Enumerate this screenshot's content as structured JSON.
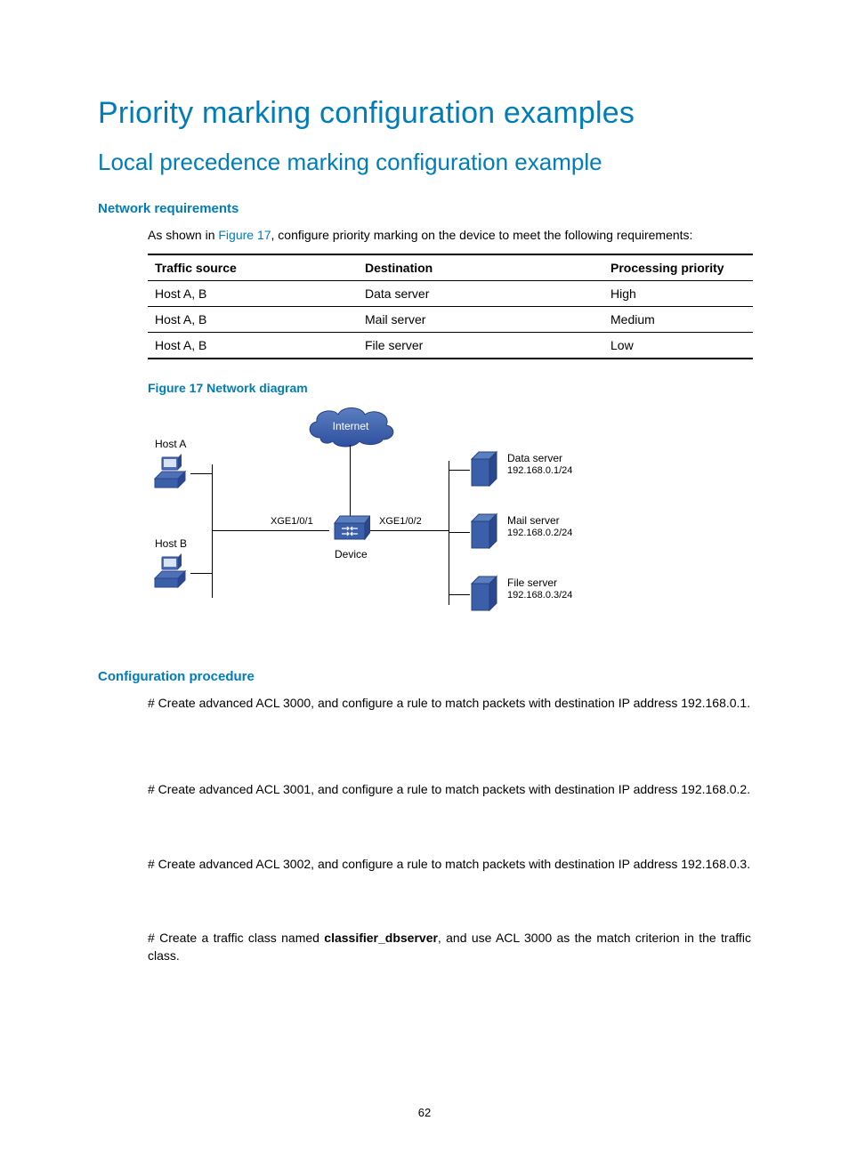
{
  "title": "Priority marking configuration examples",
  "subtitle": "Local precedence marking configuration example",
  "sections": {
    "network_req": "Network requirements",
    "config_proc": "Configuration procedure"
  },
  "intro": {
    "pre": "As shown in ",
    "link": "Figure 17",
    "post": ", configure priority marking on the device to meet the following requirements:"
  },
  "table": {
    "headers": [
      "Traffic source",
      "Destination",
      "Processing priority"
    ],
    "rows": [
      [
        "Host A, B",
        "Data server",
        "High"
      ],
      [
        "Host A, B",
        "Mail server",
        "Medium"
      ],
      [
        "Host A, B",
        "File server",
        "Low"
      ]
    ]
  },
  "figure_caption": "Figure 17 Network diagram",
  "diagram": {
    "internet": "Internet",
    "host_a": "Host A",
    "host_b": "Host B",
    "xge1": "XGE1/0/1",
    "xge2": "XGE1/0/2",
    "device": "Device",
    "data_server": "Data server",
    "data_ip": "192.168.0.1/24",
    "mail_server": "Mail server",
    "mail_ip": "192.168.0.2/24",
    "file_server": "File server",
    "file_ip": "192.168.0.3/24"
  },
  "procedure": {
    "p1": "# Create advanced ACL 3000, and configure a rule to match packets with destination IP address 192.168.0.1.",
    "p2": "# Create advanced ACL 3001, and configure a rule to match packets with destination IP address 192.168.0.2.",
    "p3": "# Create advanced ACL 3002, and configure a rule to match packets with destination IP address 192.168.0.3.",
    "p4_pre": "# Create a traffic class named ",
    "p4_bold": "classifier_dbserver",
    "p4_post": ", and use ACL 3000 as the match criterion in the traffic class."
  },
  "page_number": "62"
}
